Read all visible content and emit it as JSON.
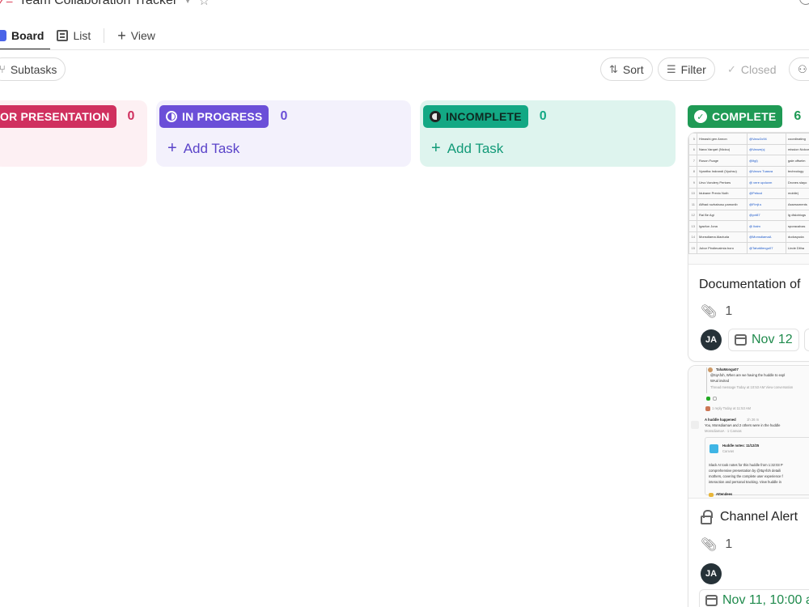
{
  "header": {
    "title": "Team Collaboration Tracker"
  },
  "tabs": [
    {
      "label": "Board"
    },
    {
      "label": "List"
    },
    {
      "label": "View"
    }
  ],
  "toolbar": {
    "subtasks": "Subtasks",
    "sort": "Sort",
    "filter": "Filter",
    "closed": "Closed"
  },
  "columns": [
    {
      "status": "OR PRESENTATION",
      "count": "0",
      "color": "#d0305f"
    },
    {
      "status": "IN PROGRESS",
      "count": "0",
      "color": "#6b4fd8",
      "add_label": "Add Task"
    },
    {
      "status": "INCOMPLETE",
      "count": "0",
      "color": "#13a884",
      "add_label": "Add Task"
    },
    {
      "status": "COMPLETE",
      "count": "6",
      "color": "#1f9a55"
    }
  ],
  "cards": [
    {
      "title": "Documentation of",
      "attachments": "1",
      "assignee_initials": "JA",
      "due": "Nov 12",
      "thumbnail_rows": [
        {
          "n": "5",
          "a": "Himashi gen Annon",
          "b": "@Vanz2o94",
          "c": "coordinating"
        },
        {
          "n": "6",
          "a": "Nana Varqart (Nicicu)",
          "b": "@Vanze(cj",
          "c": "mission Nolcor"
        },
        {
          "n": "7",
          "a": "Ruson Fuage",
          "b": "@Itgl)",
          "c": "gale offselm"
        },
        {
          "n": "8",
          "a": "Vyantha Indrandi (Vyuhsv)",
          "b": "@Vanzo Tuasva",
          "c": "technology"
        },
        {
          "n": "9",
          "a": "Urvo Vondery Pertoes",
          "b": "@ vere upduvm",
          "c": "Drones slayo"
        },
        {
          "n": "10",
          "a": "Idubane Prexio Noth",
          "b": "@Pebcol",
          "c": "mobile)"
        },
        {
          "n": "11",
          "a": "Alfhad ruzhabusu pamonib",
          "b": "@Firrjt.s",
          "c": "Assessments"
        },
        {
          "n": "12",
          "a": "Rai Be Agi",
          "b": "@yvt87",
          "c": "lg dlsloblogs"
        },
        {
          "n": "13",
          "a": "Igacfun Jona",
          "b": "@ Itaim",
          "c": "sporacalvas"
        },
        {
          "n": "14",
          "a": "Monsdiama Alactuda",
          "b": "@MonsdiamaA",
          "c": "dudusyuda"
        },
        {
          "n": "15",
          "a": "Jubor Pindiecalmia boro",
          "b": "@TahaMengu07",
          "c": "Linde Dliha"
        }
      ]
    },
    {
      "title": "Channel Alert",
      "attachments": "1",
      "assignee_initials": "JA",
      "due": "Nov 11, 10:00 a",
      "thumbnail_chat": {
        "author": "TahaMongu07",
        "line1": "@ItqAfoh, When are we having the huddle to expl",
        "line2": "WAal invited",
        "line3": "Thread message Today at 10:53 AM View conversation",
        "reply": "1 reply Today at 11:53 AM",
        "huddle_title": "A huddle happened",
        "huddle_time": "1h 26 m",
        "huddle_people": "You, MonsdiamaA and 2 others were in the huddle",
        "huddle_link": "MonsdiamaA · 1 Canvas",
        "notes_title": "Huddle notes: 11/12/25",
        "notes_sub": "Canvas",
        "notes_body1": "Slack AI took notes for this huddle from 1:32:03 P",
        "notes_body2": "comprehensive presentation by @ItqAfoh detaili",
        "notes_body3": "mothers, covering the complete user experience f",
        "notes_body4": "interaction and personal tracking. View huddle in",
        "attendees": "Attendees"
      }
    }
  ]
}
